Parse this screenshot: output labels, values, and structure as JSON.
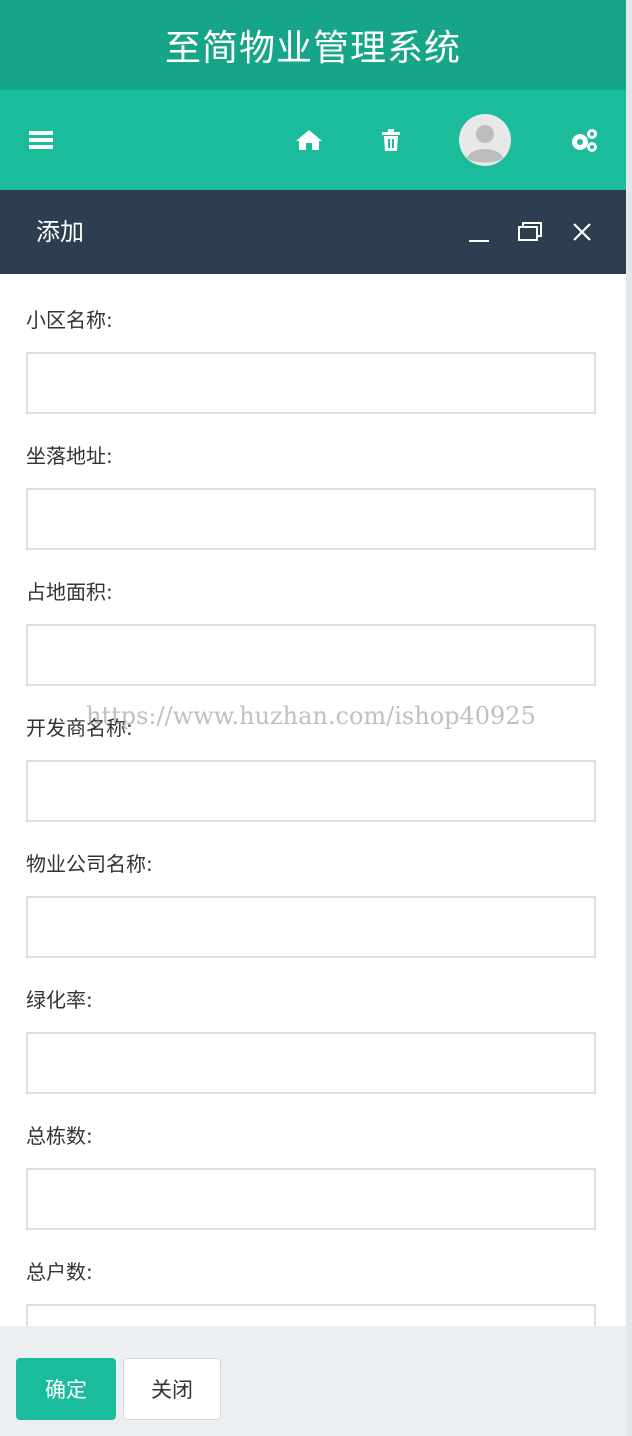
{
  "app": {
    "title": "至简物业管理系统"
  },
  "nav": {
    "icons": [
      "menu-icon",
      "home-icon",
      "trash-icon",
      "avatar",
      "gears-icon"
    ]
  },
  "dialog": {
    "title": "添加",
    "controls": [
      "minimize-icon",
      "maximize-icon",
      "close-icon"
    ]
  },
  "form": {
    "fields": [
      {
        "label": "小区名称:",
        "value": ""
      },
      {
        "label": "坐落地址:",
        "value": ""
      },
      {
        "label": "占地面积:",
        "value": ""
      },
      {
        "label": "开发商名称:",
        "value": ""
      },
      {
        "label": "物业公司名称:",
        "value": ""
      },
      {
        "label": "绿化率:",
        "value": ""
      },
      {
        "label": "总栋数:",
        "value": ""
      },
      {
        "label": "总户数:",
        "value": ""
      }
    ]
  },
  "footer": {
    "confirm_label": "确定",
    "close_label": "关闭"
  },
  "watermark": "https://www.huzhan.com/ishop40925",
  "colors": {
    "title_bar": "#17a589",
    "nav_bar": "#1abc9c",
    "dialog_header": "#2c3e50",
    "footer": "#eceff1",
    "confirm_button": "#1abc9c"
  }
}
